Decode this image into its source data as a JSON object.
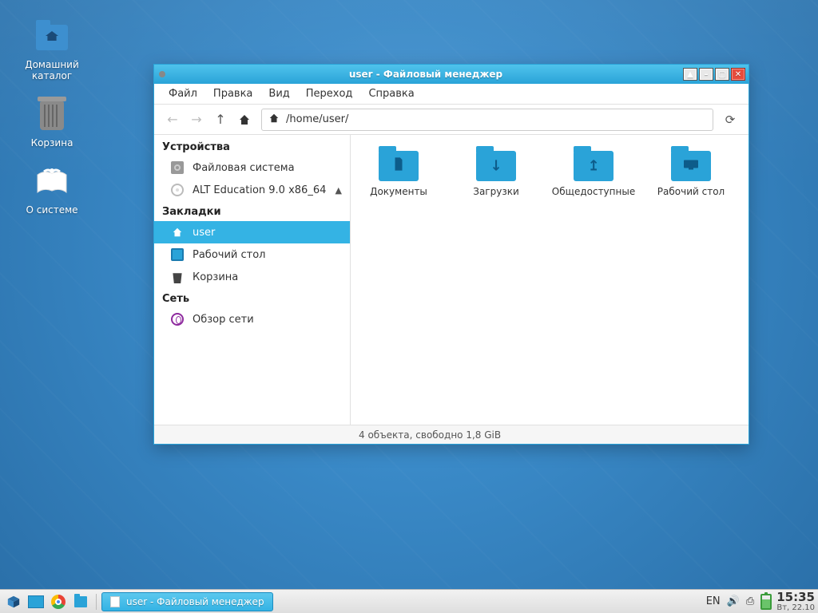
{
  "desktop": {
    "icons": [
      {
        "label": "Домашний каталог",
        "icon": "home-folder"
      },
      {
        "label": "Корзина",
        "icon": "trash"
      },
      {
        "label": "О системе",
        "icon": "about-book"
      }
    ]
  },
  "window": {
    "title": "user - Файловый менеджер",
    "menu": [
      "Файл",
      "Правка",
      "Вид",
      "Переход",
      "Справка"
    ],
    "path": "/home/user/",
    "sidebar": {
      "devices_header": "Устройства",
      "devices": [
        {
          "label": "Файловая система",
          "icon": "disk"
        },
        {
          "label": "ALT Education 9.0 x86_64",
          "icon": "cd",
          "ejectable": true
        }
      ],
      "bookmarks_header": "Закладки",
      "bookmarks": [
        {
          "label": "user",
          "icon": "home",
          "selected": true
        },
        {
          "label": "Рабочий стол",
          "icon": "desktop"
        },
        {
          "label": "Корзина",
          "icon": "trash"
        }
      ],
      "network_header": "Сеть",
      "network": [
        {
          "label": "Обзор сети",
          "icon": "globe"
        }
      ]
    },
    "folders": [
      {
        "label": "Документы",
        "mark": "doc"
      },
      {
        "label": "Загрузки",
        "mark": "download"
      },
      {
        "label": "Общедоступные",
        "mark": "public"
      },
      {
        "label": "Рабочий стол",
        "mark": "desktop"
      }
    ],
    "status": "4 объекта, свободно 1,8 GiB"
  },
  "taskbar": {
    "task_label": "user - Файловый менеджер",
    "lang": "EN",
    "time": "15:35",
    "date": "Вт, 22.10"
  }
}
